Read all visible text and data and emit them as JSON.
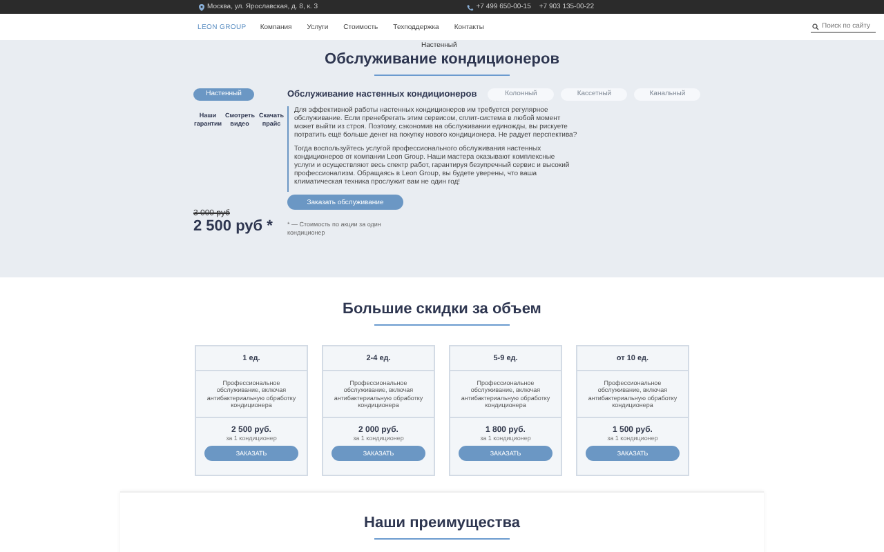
{
  "top_bar": {
    "address": "Москва, ул. Ярославская, д. 8, к. 3",
    "phones": [
      "+7 499 650-00-15",
      "+7 903 135-00-22"
    ]
  },
  "header": {
    "logo": "LEON GROUP",
    "nav": [
      "Компания",
      "Услуги",
      "Стоимость",
      "Техподдержка",
      "Контакты"
    ],
    "search": {
      "placeholder": "Поиск по сайту"
    }
  },
  "tooltip": "Настенный",
  "hero": {
    "title": "Обслуживание кондиционеров",
    "tabs": [
      {
        "label": "Настенный",
        "selected": true
      },
      {
        "label": "Колонный",
        "selected": false
      },
      {
        "label": "Кассетный",
        "selected": false
      },
      {
        "label": "Канальный",
        "selected": false
      }
    ],
    "links": [
      "Наши гарантии",
      "Смотреть видео",
      "Скачать прайс"
    ],
    "heading": "Обслуживание настенных кондиционеров",
    "paragraphs": [
      "Для эффективной работы настенных кондиционеров им требуется регулярное обслуживание. Если пренебрегать этим сервисом, сплит-система в любой момент может выйти из строя. Поэтому, сэкономив на обслуживании единожды, вы рискуете потратить ещё больше денег на покупку нового кондиционера. Не радует перспектива?",
      "Тогда воспользуйтесь услугой профессионального обслуживания настенных кондиционеров от компании Leon Group. Наши мастера оказывают комплексные услуги и осуществляют весь спектр работ, гарантируя безупречный сервис и высокий профессионализм. Обращаясь в Leon Group, вы будете уверены, что ваша климатическая техника прослужит вам не один год!"
    ],
    "order_button": "Заказать обслуживание",
    "old_price": "3 000 руб",
    "price": "2 500 руб *",
    "footnote": "* — Стоимость по акции за один кондиционер"
  },
  "discounts": {
    "title": "Большие скидки за объем",
    "cards": [
      {
        "quantity": "1 ед.",
        "description": "Профессиональное обслуживание, включая антибактериальную обработку кондиционера",
        "price": "2 500 руб.",
        "unit": "за 1 кондиционер",
        "button": "ЗАКАЗАТЬ"
      },
      {
        "quantity": "2-4 ед.",
        "description": "Профессиональное обслуживание, включая антибактериальную обработку кондиционера",
        "price": "2 000 руб.",
        "unit": "за 1 кондиционер",
        "button": "ЗАКАЗАТЬ"
      },
      {
        "quantity": "5-9 ед.",
        "description": "Профессиональное обслуживание, включая антибактериальную обработку кондиционера",
        "price": "1 800 руб.",
        "unit": "за 1 кондиционер",
        "button": "ЗАКАЗАТЬ"
      },
      {
        "quantity": "от 10 ед.",
        "description": "Профессиональное обслуживание, включая антибактериальную обработку кондиционера",
        "price": "1 500 руб.",
        "unit": "за 1 кондиционер",
        "button": "ЗАКАЗАТЬ"
      }
    ]
  },
  "advantages": {
    "title": "Наши преимущества"
  }
}
